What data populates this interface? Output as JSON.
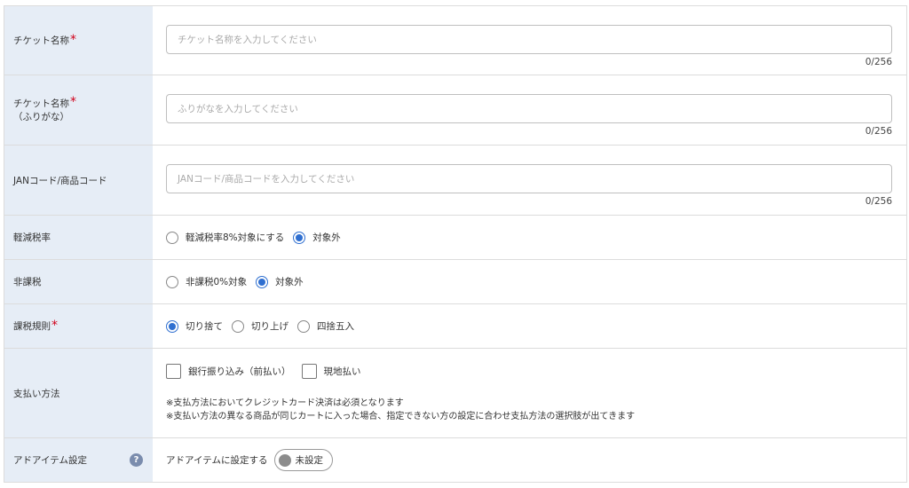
{
  "rows": {
    "ticket_name": {
      "label": "チケット名称",
      "required": "*",
      "placeholder": "チケット名称を入力してください",
      "counter": "0/256"
    },
    "ticket_kana": {
      "label_line1": "チケット名称",
      "label_line2": "（ふりがな）",
      "required": "*",
      "placeholder": "ふりがなを入力してください",
      "counter": "0/256"
    },
    "jan_code": {
      "label": "JANコード/商品コード",
      "placeholder": "JANコード/商品コードを入力してください",
      "counter": "0/256"
    },
    "reduced_tax": {
      "label": "軽減税率",
      "options": [
        "軽減税率8%対象にする",
        "対象外"
      ],
      "selected": "対象外"
    },
    "tax_exempt": {
      "label": "非課税",
      "options": [
        "非課税0%対象",
        "対象外"
      ],
      "selected": "対象外"
    },
    "tax_rule": {
      "label": "課税規則",
      "required": "*",
      "options": [
        "切り捨て",
        "切り上げ",
        "四捨五入"
      ],
      "selected": "切り捨て"
    },
    "payment": {
      "label": "支払い方法",
      "options": [
        "銀行振り込み（前払い）",
        "現地払い"
      ],
      "note1": "※支払方法においてクレジットカード決済は必須となります",
      "note2": "※支払い方法の異なる商品が同じカートに入った場合、指定できない方の設定に合わせ支払方法の選択肢が出てきます"
    },
    "ad_item": {
      "label": "アドアイテム設定",
      "help": "?",
      "toggle_label": "アドアイテムに設定する",
      "toggle_state": "未設定"
    }
  }
}
